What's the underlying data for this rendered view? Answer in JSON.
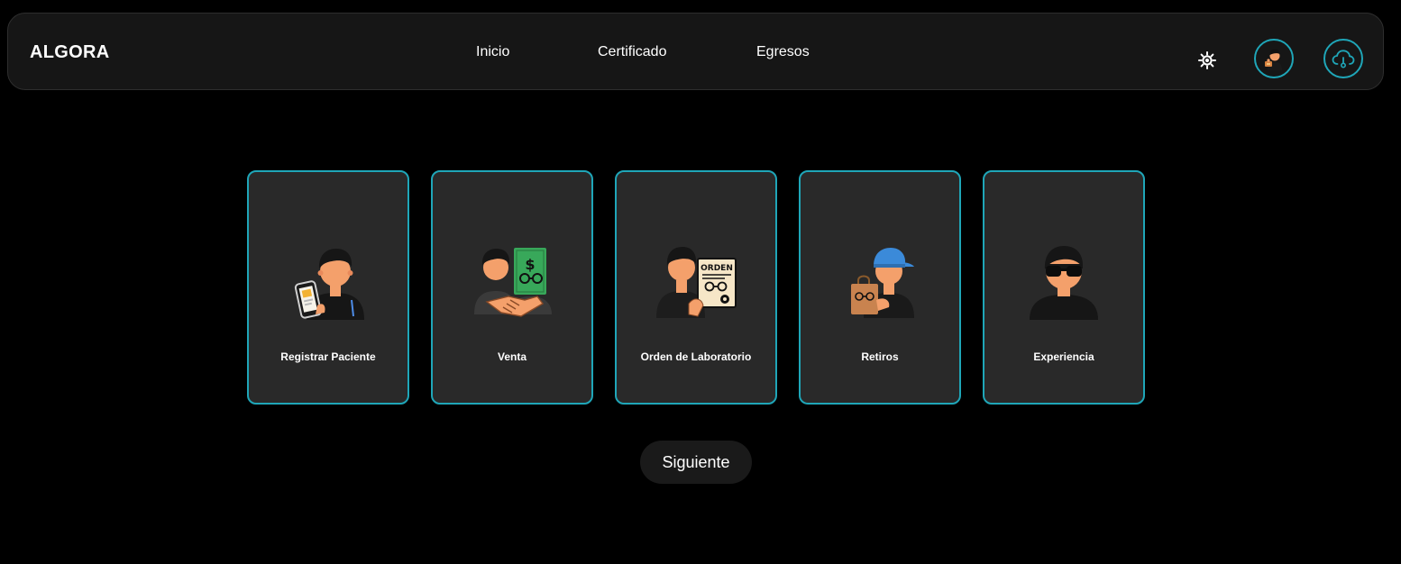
{
  "header": {
    "brand": "ALGORA",
    "nav": [
      {
        "label": "Inicio"
      },
      {
        "label": "Certificado"
      },
      {
        "label": "Egresos"
      }
    ],
    "theme_icon": "sun-icon",
    "user_icon": "user-avatar-icon",
    "cloud_icon": "cloud-icon"
  },
  "cards": [
    {
      "label": "Registrar Paciente",
      "icon": "person-with-phone-icon"
    },
    {
      "label": "Venta",
      "icon": "handshake-money-icon"
    },
    {
      "label": "Orden de Laboratorio",
      "icon": "lab-order-icon"
    },
    {
      "label": "Retiros",
      "icon": "person-with-bag-icon"
    },
    {
      "label": "Experiencia",
      "icon": "person-with-sunglasses-icon"
    }
  ],
  "illustration_text": {
    "dollar": "$",
    "orden": "ORDEN"
  },
  "footer": {
    "next_label": "Siguiente"
  },
  "colors": {
    "accent": "#1fa6b8",
    "card_bg": "#292929",
    "nav_bg": "#161616",
    "skin": "#f4a06b",
    "hair": "#161616"
  }
}
